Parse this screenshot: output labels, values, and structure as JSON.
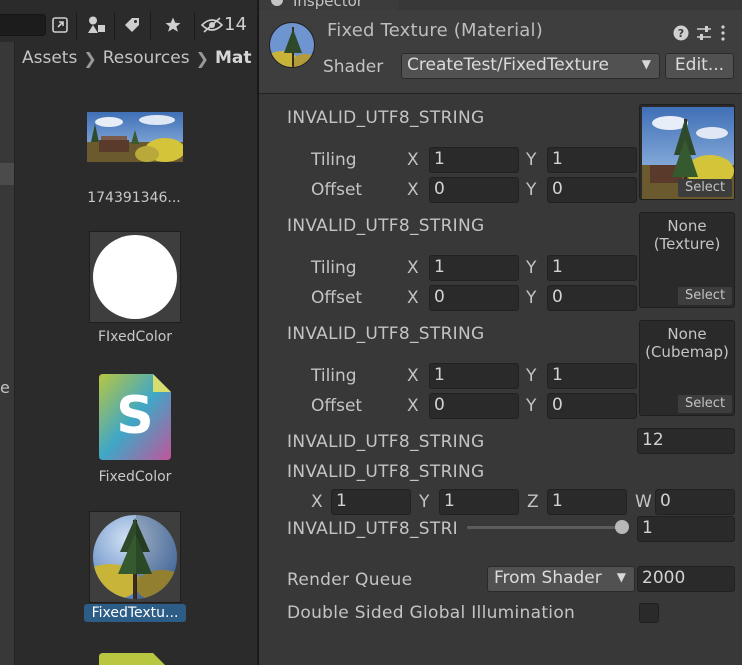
{
  "project": {
    "toolbar": {
      "hidden_count": "14"
    },
    "breadcrumb": [
      "Assets",
      "Resources",
      "Mat"
    ],
    "tree_letter": "e",
    "assets": [
      {
        "label": "174391346...",
        "icon": "photo-landscape-thumbnail",
        "selected": false
      },
      {
        "label": "FIxedColor",
        "icon": "white-sphere-material-thumbnail",
        "selected": false
      },
      {
        "label": "FixedColor",
        "icon": "shader-file-icon",
        "selected": false,
        "glyph": "S"
      },
      {
        "label": "FixedTextu...",
        "icon": "textured-sphere-material-thumbnail",
        "selected": true
      }
    ]
  },
  "inspector": {
    "tab_label": "Inspector",
    "title": "Fixed Texture (Material)",
    "shader_label": "Shader",
    "shader_value": "CreateTest/FixedTexture",
    "edit_label": "Edit...",
    "textures": [
      {
        "label": "INVALID_UTF8_STRING",
        "tiling_x": "1",
        "tiling_y": "1",
        "offset_x": "0",
        "offset_y": "0",
        "slot_line1": "",
        "slot_line2": "",
        "has_image": true
      },
      {
        "label": "INVALID_UTF8_STRING",
        "tiling_x": "1",
        "tiling_y": "1",
        "offset_x": "0",
        "offset_y": "0",
        "slot_line1": "None",
        "slot_line2": "(Texture)",
        "has_image": false
      },
      {
        "label": "INVALID_UTF8_STRING",
        "tiling_x": "1",
        "tiling_y": "1",
        "offset_x": "0",
        "offset_y": "0",
        "slot_line1": "None",
        "slot_line2": "(Cubemap)",
        "has_image": false
      }
    ],
    "tiling_label": "Tiling",
    "offset_label": "Offset",
    "axis_x": "X",
    "axis_y": "Y",
    "axis_z": "Z",
    "axis_w": "W",
    "select_label": "Select",
    "float_prop": {
      "label": "INVALID_UTF8_STRING",
      "value": "12"
    },
    "vector_prop": {
      "label": "INVALID_UTF8_STRING",
      "x": "1",
      "y": "1",
      "z": "1",
      "w": "0"
    },
    "range_prop": {
      "label": "INVALID_UTF8_STRI",
      "value": "1",
      "fraction": 1.0
    },
    "render_queue": {
      "label": "Render Queue",
      "mode": "From Shader",
      "value": "2000"
    },
    "dsgi": {
      "label": "Double Sided Global Illumination",
      "checked": false
    }
  },
  "colors": {
    "selection": "#2c5d87",
    "inspector_bg": "#383838",
    "project_bg": "#2b2b2b",
    "field_bg": "#2a2a2a"
  }
}
